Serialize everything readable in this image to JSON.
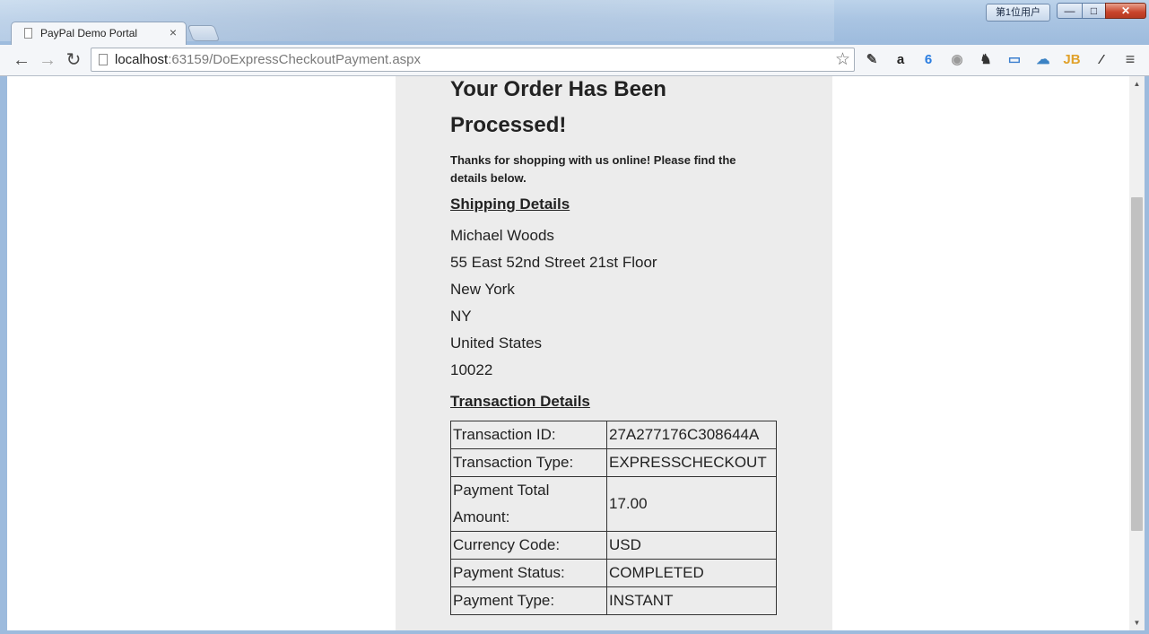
{
  "window": {
    "user_badge": "第1位用户",
    "minimize_glyph": "—",
    "maximize_glyph": "□",
    "close_glyph": "✕"
  },
  "tab": {
    "title": "PayPal Demo Portal",
    "close_glyph": "×"
  },
  "toolbar": {
    "back_glyph": "←",
    "forward_glyph": "→",
    "reload_glyph": "↻",
    "url_host": "localhost",
    "url_rest": ":63159/DoExpressCheckoutPayment.aspx",
    "star_glyph": "☆",
    "extensions": [
      {
        "name": "pin-extension-icon",
        "glyph": "✎",
        "color": "#444444"
      },
      {
        "name": "amazon-extension-icon",
        "glyph": "a",
        "color": "#222222"
      },
      {
        "name": "blue-extension-icon",
        "glyph": "6",
        "color": "#2a7de1"
      },
      {
        "name": "globe-extension-icon",
        "glyph": "◉",
        "color": "#9a9a9a"
      },
      {
        "name": "evernote-extension-icon",
        "glyph": "♞",
        "color": "#333333"
      },
      {
        "name": "folder-extension-icon",
        "glyph": "▭",
        "color": "#3b7fcf"
      },
      {
        "name": "cloud-extension-icon",
        "glyph": "☁",
        "color": "#3b82c4"
      },
      {
        "name": "jetbrains-extension-icon",
        "glyph": "JB",
        "color": "#e0a12b"
      },
      {
        "name": "eyedropper-extension-icon",
        "glyph": "⁄",
        "color": "#333333"
      }
    ],
    "menu_glyph": "≡"
  },
  "page": {
    "title": "Your Order Has Been Processed!",
    "intro": "Thanks for shopping with us online! Please find the details below.",
    "shipping_heading": "Shipping Details",
    "shipping_lines": [
      "Michael Woods",
      "55 East 52nd Street 21st Floor",
      "New York",
      "NY",
      "United States",
      "10022"
    ],
    "transaction_heading": "Transaction Details",
    "transaction_rows": [
      {
        "label": "Transaction ID:",
        "value": "27A277176C308644A"
      },
      {
        "label": "Transaction Type:",
        "value": "EXPRESSCHECKOUT"
      },
      {
        "label": "Payment Total Amount:",
        "value": "17.00"
      },
      {
        "label": "Currency Code:",
        "value": "USD"
      },
      {
        "label": "Payment Status:",
        "value": "COMPLETED"
      },
      {
        "label": "Payment Type:",
        "value": "INSTANT"
      }
    ]
  },
  "scrollbar": {
    "up_glyph": "▲",
    "down_glyph": "▼"
  }
}
